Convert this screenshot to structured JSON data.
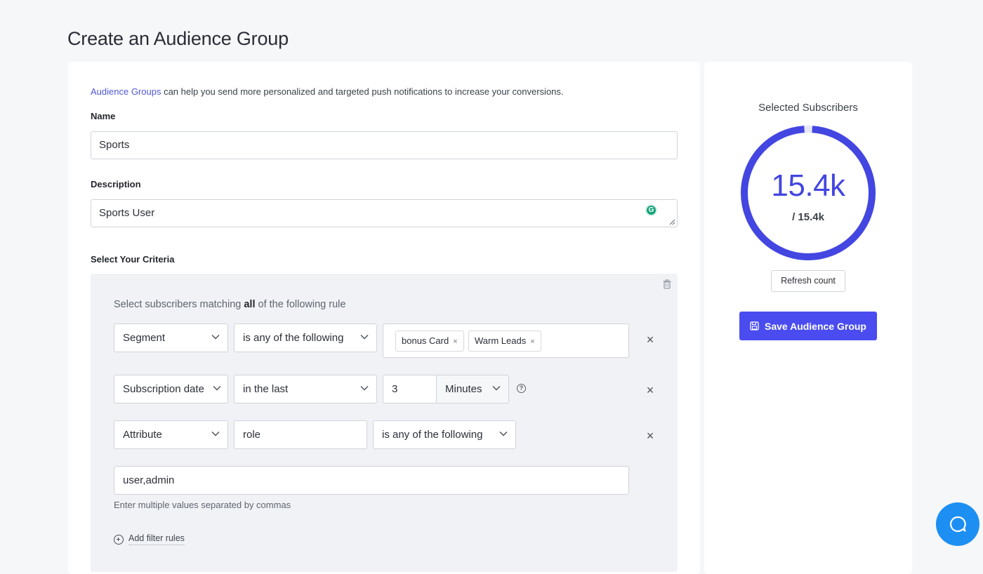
{
  "page": {
    "title": "Create an Audience Group"
  },
  "intro": {
    "link_text": "Audience Groups",
    "text": " can help you send more personalized and targeted push notifications to increase your conversions."
  },
  "name_field": {
    "label": "Name",
    "value": "Sports"
  },
  "description_field": {
    "label": "Description",
    "value": "Sports User"
  },
  "criteria": {
    "label": "Select Your Criteria",
    "rule_desc_prefix": "Select subscribers matching ",
    "rule_desc_bold": "all",
    "rule_desc_suffix": " of the following rule",
    "rule1": {
      "field": "Segment",
      "operator": "is any of the following",
      "tags": [
        "bonus Card",
        "Warm Leads"
      ],
      "tag_remove_glyph": "×"
    },
    "rule2": {
      "field": "Subscription date",
      "operator": "in the last",
      "amount": "3",
      "unit": "Minutes"
    },
    "rule3": {
      "field": "Attribute",
      "attribute_name": "role",
      "operator": "is any of the following",
      "values": "user,admin"
    },
    "remove_glyph": "×",
    "help_glyph": "?",
    "hint": "Enter multiple values separated by commas",
    "add_filter": "Add filter rules"
  },
  "summary": {
    "title": "Selected Subscribers",
    "count": "15.4k",
    "total": "/ 15.4k",
    "refresh_label": "Refresh count",
    "save_label": "Save Audience Group",
    "ratio": 0.98,
    "accent_color": "#4346e0"
  }
}
